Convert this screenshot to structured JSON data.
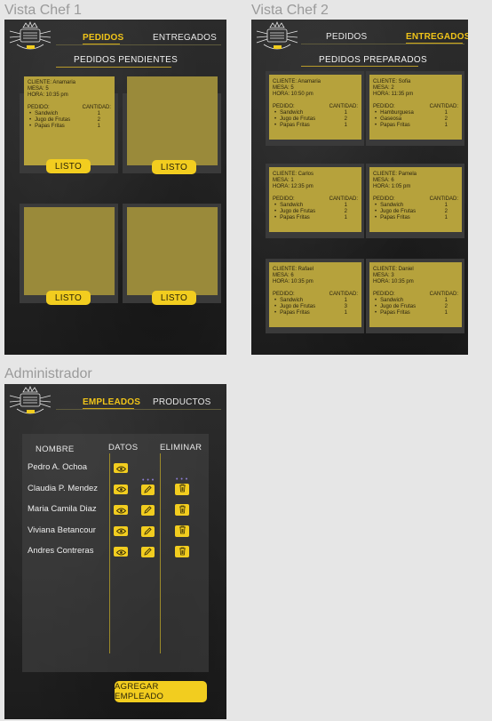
{
  "frames": {
    "chef1": "Vista Chef 1",
    "chef2": "Vista Chef 2",
    "admin": "Administrador"
  },
  "chef1": {
    "tabs": {
      "pedidos": "PEDIDOS",
      "entregados": "ENTREGADOS"
    },
    "section_title": "PEDIDOS PENDIENTES",
    "ready_label": "LISTO",
    "order": {
      "cliente": "CLIENTE: Anamaria",
      "mesa": "MESA: 5",
      "hora": "HORA: 10:35 pm",
      "pedido_label": "PEDIDO:",
      "cantidad_label": "CANTIDAD:",
      "items": [
        {
          "name": "Sandwich",
          "qty": "1"
        },
        {
          "name": "Jugo de Frutas",
          "qty": "2"
        },
        {
          "name": "Papas Fritas",
          "qty": "1"
        }
      ]
    }
  },
  "chef2": {
    "tabs": {
      "pedidos": "PEDIDOS",
      "entregados": "ENTREGADOS"
    },
    "section_title": "PEDIDOS PREPARADOS",
    "pedido_label": "PEDIDO:",
    "cantidad_label": "CANTIDAD:",
    "orders": [
      {
        "cliente": "CLIENTE: Anamaria",
        "mesa": "MESA: 5",
        "hora": "HORA: 10:50 pm",
        "items": [
          {
            "name": "Sandwich",
            "qty": "1"
          },
          {
            "name": "Jugo de Frutas",
            "qty": "2"
          },
          {
            "name": "Papas Fritas",
            "qty": "1"
          }
        ]
      },
      {
        "cliente": "CLIENTE: Sofia",
        "mesa": "MESA: 2",
        "hora": "HORA: 11:35 pm",
        "items": [
          {
            "name": "Hamburguesa",
            "qty": "1"
          },
          {
            "name": "Gaseosa",
            "qty": "2"
          },
          {
            "name": "Papas Fritas",
            "qty": "1"
          }
        ]
      },
      {
        "cliente": "CLIENTE: Carlos",
        "mesa": "MESA: 1",
        "hora": "HORA: 12:35 pm",
        "items": [
          {
            "name": "Sandwich",
            "qty": "1"
          },
          {
            "name": "Jugo de Frutas",
            "qty": "2"
          },
          {
            "name": "Papas Fritas",
            "qty": "1"
          }
        ]
      },
      {
        "cliente": "CLIENTE: Pamela",
        "mesa": "MESA: 6",
        "hora": "HORA: 1:05 pm",
        "items": [
          {
            "name": "Sandwich",
            "qty": "1"
          },
          {
            "name": "Jugo de Frutas",
            "qty": "2"
          },
          {
            "name": "Papas Fritas",
            "qty": "1"
          }
        ]
      },
      {
        "cliente": "CLIENTE: Rafael",
        "mesa": "MESA: 6",
        "hora": "HORA: 10:35 pm",
        "items": [
          {
            "name": "Sandwich",
            "qty": "1"
          },
          {
            "name": "Jugo de Frutas",
            "qty": "3"
          },
          {
            "name": "Papas Fritas",
            "qty": "1"
          }
        ]
      },
      {
        "cliente": "CLIENTE: Daniel",
        "mesa": "MESA: 3",
        "hora": "HORA: 10:35 pm",
        "items": [
          {
            "name": "Sandwich",
            "qty": "1"
          },
          {
            "name": "Jugo de Frutas",
            "qty": "2"
          },
          {
            "name": "Papas Fritas",
            "qty": "1"
          }
        ]
      }
    ]
  },
  "admin": {
    "tabs": {
      "empleados": "EMPLEADOS",
      "productos": "PRODUCTOS"
    },
    "headers": {
      "nombre": "NOMBRE",
      "datos": "DATOS",
      "eliminar": "ELIMINAR"
    },
    "employees": [
      {
        "name": "Pedro A. Ochoa",
        "edit": false,
        "delete": false
      },
      {
        "name": "Claudia P. Mendez",
        "edit": true,
        "delete": true
      },
      {
        "name": "Maria Camila Diaz",
        "edit": true,
        "delete": true
      },
      {
        "name": "Viviana Betancour",
        "edit": true,
        "delete": true
      },
      {
        "name": "Andres Contreras",
        "edit": true,
        "delete": true
      }
    ],
    "add_button": "AGREGAR EMPLEADO"
  },
  "colors": {
    "accent": "#f2cd1f",
    "card": "#b6a23c",
    "screen_bg": "#262626"
  },
  "icons": {
    "view": "eye-icon",
    "edit": "pencil-icon",
    "delete": "trash-icon",
    "logo": "chef-logo-icon"
  }
}
